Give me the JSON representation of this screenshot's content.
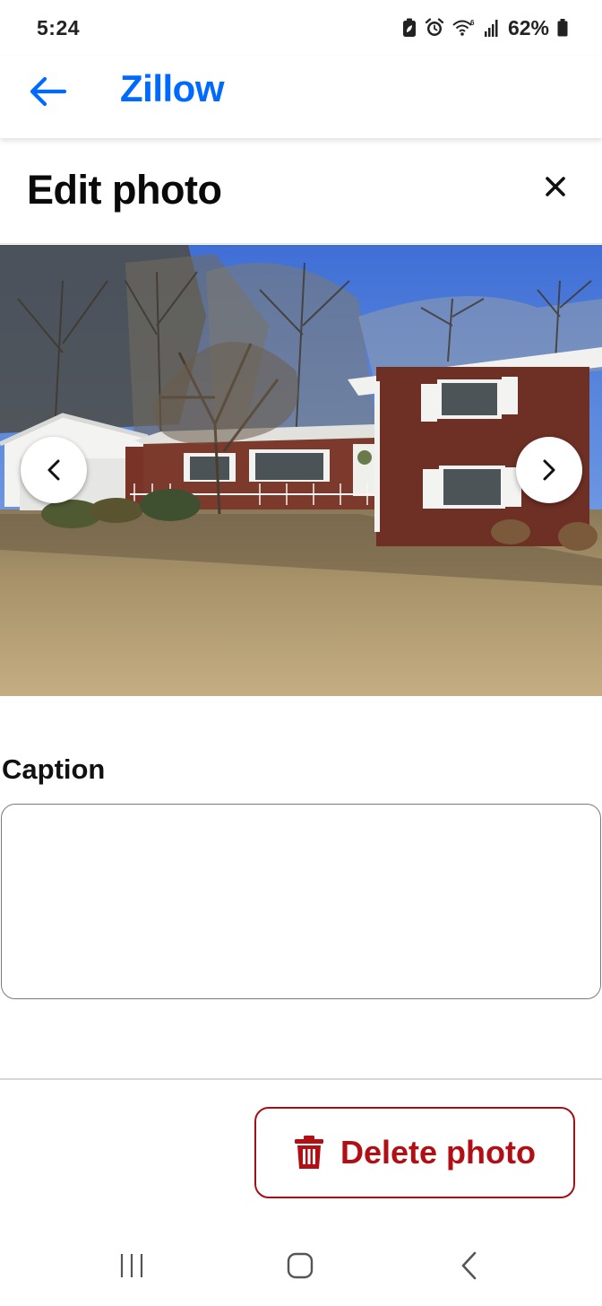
{
  "status_bar": {
    "time": "5:24",
    "battery_percent": "62%",
    "icons": [
      "battery-saver-icon",
      "alarm-icon",
      "wifi-6-icon",
      "signal-icon",
      "battery-icon"
    ]
  },
  "app_bar": {
    "title": "Zillow",
    "back_icon": "arrow-left-icon",
    "accent_color": "#006aff"
  },
  "header": {
    "title": "Edit photo",
    "close_icon": "close-icon"
  },
  "photo": {
    "prev_icon": "chevron-left-icon",
    "next_icon": "chevron-right-icon"
  },
  "caption": {
    "label": "Caption",
    "value": "",
    "placeholder": ""
  },
  "actions": {
    "delete_label": "Delete photo",
    "delete_icon": "trash-icon",
    "delete_color": "#b10f14"
  },
  "system_nav": {
    "icons": [
      "recents-icon",
      "home-icon",
      "back-icon"
    ]
  }
}
